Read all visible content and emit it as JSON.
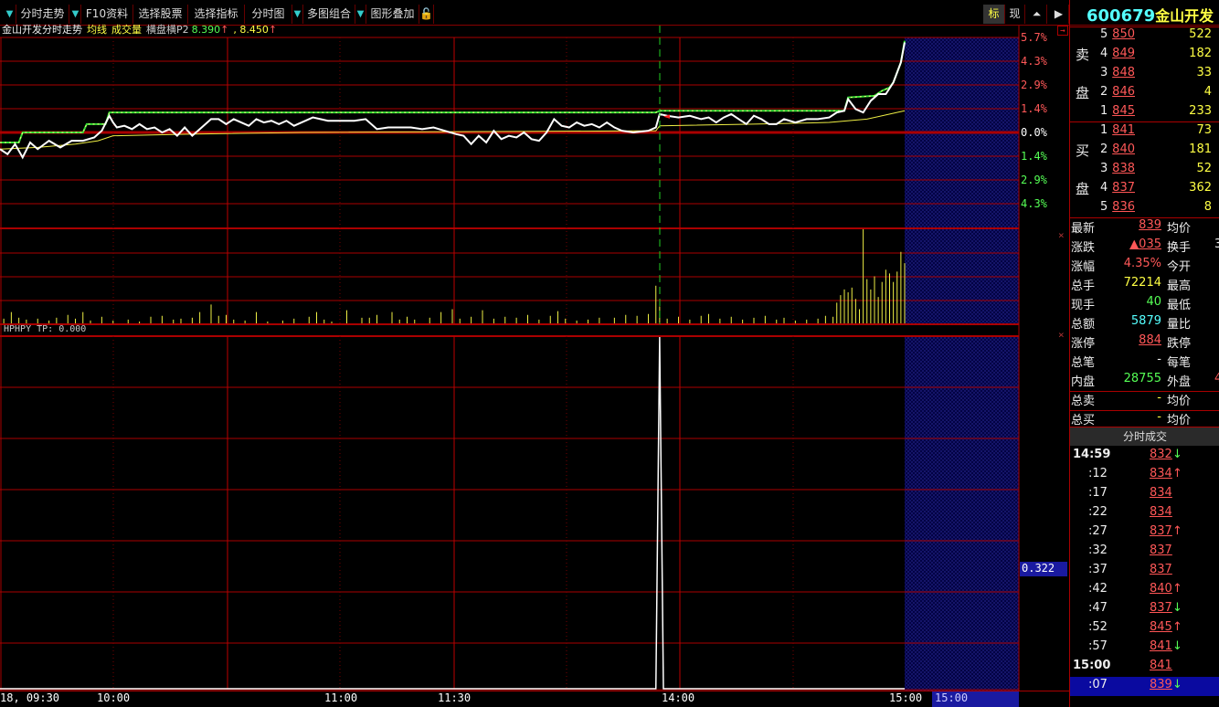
{
  "toolbar": {
    "items": [
      "分时走势",
      "F10资料",
      "选择股票",
      "选择指标",
      "分时图",
      "多图组合",
      "图形叠加"
    ],
    "right": [
      "标",
      "现"
    ]
  },
  "info": {
    "title": "金山开发分时走势",
    "ma": "均线",
    "vol": "成交量",
    "mode": "横盘横P2",
    "v1": "8.390",
    "v2": ", 8.450",
    "arrow": "↑"
  },
  "axis": {
    "price_labels": [
      "5.7%",
      "4.3%",
      "2.9%",
      "1.4%",
      "0.0%",
      "1.4%",
      "2.9%",
      "4.3%"
    ],
    "indicator_label": "HPHPY  TP: 0.000",
    "indicator_value": "0.322",
    "time_labels": [
      "18, 09:30",
      "10:00",
      "11:00",
      "11:30",
      "14:00",
      "15:00"
    ],
    "cursor_time": "15:00"
  },
  "quote": {
    "code": "600679",
    "name": "金山开发",
    "sell_label": [
      "卖",
      "盘"
    ],
    "buy_label": [
      "买",
      "盘"
    ],
    "sell": [
      {
        "lvl": "5",
        "price": "850",
        "vol": "522"
      },
      {
        "lvl": "4",
        "price": "849",
        "vol": "182"
      },
      {
        "lvl": "3",
        "price": "848",
        "vol": "33"
      },
      {
        "lvl": "2",
        "price": "846",
        "vol": "4"
      },
      {
        "lvl": "1",
        "price": "845",
        "vol": "233"
      }
    ],
    "buy": [
      {
        "lvl": "1",
        "price": "841",
        "vol": "73"
      },
      {
        "lvl": "2",
        "price": "840",
        "vol": "181"
      },
      {
        "lvl": "3",
        "price": "838",
        "vol": "52"
      },
      {
        "lvl": "4",
        "price": "837",
        "vol": "362"
      },
      {
        "lvl": "5",
        "price": "836",
        "vol": "8"
      }
    ],
    "stats": [
      {
        "l": "最新",
        "v": "839",
        "c": "red",
        "r": "均价",
        "rv": ""
      },
      {
        "l": "涨跌",
        "v": "▲035",
        "c": "red",
        "r": "换手",
        "rv": "3"
      },
      {
        "l": "涨幅",
        "v": "4.35%",
        "c": "red",
        "r": "今开",
        "rv": ""
      },
      {
        "l": "总手",
        "v": "72214",
        "c": "yel",
        "r": "最高",
        "rv": ""
      },
      {
        "l": "现手",
        "v": "40",
        "c": "grn",
        "r": "最低",
        "rv": ""
      },
      {
        "l": "总额",
        "v": "5879",
        "c": "cyn",
        "r": "量比",
        "rv": ""
      },
      {
        "l": "涨停",
        "v": "884",
        "c": "red",
        "r": "跌停",
        "rv": ""
      },
      {
        "l": "总笔",
        "v": "-",
        "c": "wht",
        "r": "每笔",
        "rv": ""
      },
      {
        "l": "内盘",
        "v": "28755",
        "c": "grn",
        "r": "外盘",
        "rv": "4"
      },
      {
        "l": "总卖",
        "v": "-",
        "c": "yel",
        "r": "均价",
        "rv": ""
      },
      {
        "l": "总买",
        "v": "-",
        "c": "yel",
        "r": "均价",
        "rv": ""
      }
    ],
    "ticks_header": "分时成交",
    "ticks": [
      {
        "t": "14:59",
        "p": "832",
        "d": "↓"
      },
      {
        "t": ":12",
        "p": "834",
        "d": "↑"
      },
      {
        "t": ":17",
        "p": "834",
        "d": ""
      },
      {
        "t": ":22",
        "p": "834",
        "d": ""
      },
      {
        "t": ":27",
        "p": "837",
        "d": "↑"
      },
      {
        "t": ":32",
        "p": "837",
        "d": ""
      },
      {
        "t": ":37",
        "p": "837",
        "d": ""
      },
      {
        "t": ":42",
        "p": "840",
        "d": "↑"
      },
      {
        "t": ":47",
        "p": "837",
        "d": "↓"
      },
      {
        "t": ":52",
        "p": "845",
        "d": "↑"
      },
      {
        "t": ":57",
        "p": "841",
        "d": "↓"
      },
      {
        "t": "15:00",
        "p": "841",
        "d": ""
      },
      {
        "t": ":07",
        "p": "839",
        "d": "↓"
      }
    ]
  },
  "chart_data": {
    "type": "line",
    "prev_close": 8.04,
    "ylim_pct": [
      -5.7,
      5.7
    ],
    "x_minutes": [
      0,
      240
    ],
    "price": [
      [
        0,
        -1.0
      ],
      [
        2,
        -1.3
      ],
      [
        4,
        -0.7
      ],
      [
        6,
        -1.5
      ],
      [
        8,
        -0.6
      ],
      [
        10,
        -1.0
      ],
      [
        13,
        -0.5
      ],
      [
        16,
        -0.9
      ],
      [
        19,
        -0.5
      ],
      [
        22,
        -0.5
      ],
      [
        25,
        -0.3
      ],
      [
        27,
        0.1
      ],
      [
        29,
        1.0
      ],
      [
        30,
        0.6
      ],
      [
        31,
        0.3
      ],
      [
        33,
        0.4
      ],
      [
        35,
        0.2
      ],
      [
        37,
        0.5
      ],
      [
        39,
        0.2
      ],
      [
        41,
        0.3
      ],
      [
        43,
        0.0
      ],
      [
        45,
        0.2
      ],
      [
        47,
        -0.2
      ],
      [
        49,
        0.3
      ],
      [
        51,
        -0.2
      ],
      [
        53,
        0.2
      ],
      [
        56,
        0.8
      ],
      [
        58,
        0.8
      ],
      [
        60,
        0.5
      ],
      [
        62,
        0.8
      ],
      [
        64,
        0.6
      ],
      [
        66,
        0.4
      ],
      [
        68,
        0.8
      ],
      [
        70,
        0.6
      ],
      [
        72,
        0.7
      ],
      [
        74,
        0.5
      ],
      [
        76,
        0.7
      ],
      [
        78,
        0.4
      ],
      [
        80,
        0.6
      ],
      [
        83,
        0.9
      ],
      [
        85,
        0.8
      ],
      [
        87,
        0.7
      ],
      [
        90,
        0.7
      ],
      [
        94,
        0.7
      ],
      [
        97,
        0.8
      ],
      [
        100,
        0.2
      ],
      [
        103,
        0.3
      ],
      [
        106,
        0.3
      ],
      [
        109,
        0.3
      ],
      [
        112,
        0.2
      ],
      [
        115,
        0.3
      ],
      [
        118,
        0.1
      ],
      [
        121,
        -0.1
      ],
      [
        123,
        -0.2
      ],
      [
        125,
        -0.7
      ],
      [
        127,
        -0.2
      ],
      [
        129,
        -0.6
      ],
      [
        131,
        0.1
      ],
      [
        133,
        -0.4
      ],
      [
        135,
        -0.2
      ],
      [
        137,
        -0.3
      ],
      [
        139,
        0.0
      ],
      [
        141,
        -0.4
      ],
      [
        143,
        -0.5
      ],
      [
        145,
        0.0
      ],
      [
        147,
        0.8
      ],
      [
        149,
        0.4
      ],
      [
        151,
        0.3
      ],
      [
        153,
        0.6
      ],
      [
        155,
        0.4
      ],
      [
        157,
        0.5
      ],
      [
        159,
        0.3
      ],
      [
        161,
        0.6
      ],
      [
        163,
        0.3
      ],
      [
        165,
        0.1
      ],
      [
        168,
        0.0
      ],
      [
        172,
        0.1
      ],
      [
        174,
        0.3
      ],
      [
        175,
        1.1
      ],
      [
        177,
        1.0
      ],
      [
        180,
        0.9
      ],
      [
        183,
        1.0
      ],
      [
        186,
        0.8
      ],
      [
        188,
        0.9
      ],
      [
        190,
        0.6
      ],
      [
        192,
        0.9
      ],
      [
        194,
        1.1
      ],
      [
        196,
        0.8
      ],
      [
        198,
        0.5
      ],
      [
        200,
        1.0
      ],
      [
        202,
        0.8
      ],
      [
        204,
        0.5
      ],
      [
        206,
        0.5
      ],
      [
        208,
        0.8
      ],
      [
        211,
        0.6
      ],
      [
        214,
        0.8
      ],
      [
        217,
        0.8
      ],
      [
        220,
        0.9
      ],
      [
        222,
        1.2
      ],
      [
        224,
        1.3
      ],
      [
        225,
        2.0
      ],
      [
        227,
        1.4
      ],
      [
        229,
        1.2
      ],
      [
        231,
        1.9
      ],
      [
        233,
        2.3
      ],
      [
        235,
        2.3
      ],
      [
        237,
        3.0
      ],
      [
        239,
        4.2
      ],
      [
        240,
        5.4
      ]
    ],
    "high": [
      [
        0,
        -0.6
      ],
      [
        5,
        -0.6
      ],
      [
        6,
        0.0
      ],
      [
        22,
        0.0
      ],
      [
        23,
        0.5
      ],
      [
        28,
        0.5
      ],
      [
        29,
        1.2
      ],
      [
        174,
        1.2
      ],
      [
        175,
        1.3
      ],
      [
        224,
        1.3
      ],
      [
        225,
        2.1
      ],
      [
        232,
        2.2
      ],
      [
        234,
        2.5
      ],
      [
        236,
        2.7
      ],
      [
        237,
        3.0
      ],
      [
        239,
        4.2
      ],
      [
        240,
        5.5
      ]
    ],
    "avg": [
      [
        0,
        -1.0
      ],
      [
        10,
        -0.9
      ],
      [
        20,
        -0.7
      ],
      [
        26,
        -0.5
      ],
      [
        30,
        -0.2
      ],
      [
        50,
        -0.1
      ],
      [
        80,
        0.0
      ],
      [
        174,
        0.1
      ],
      [
        175,
        0.4
      ],
      [
        200,
        0.5
      ],
      [
        220,
        0.6
      ],
      [
        230,
        0.8
      ],
      [
        240,
        1.3
      ]
    ],
    "volume": [
      [
        1,
        5
      ],
      [
        3,
        12
      ],
      [
        5,
        6
      ],
      [
        7,
        4
      ],
      [
        10,
        5
      ],
      [
        13,
        3
      ],
      [
        15,
        6
      ],
      [
        18,
        9
      ],
      [
        20,
        5
      ],
      [
        22,
        12
      ],
      [
        24,
        3
      ],
      [
        27,
        7
      ],
      [
        30,
        3
      ],
      [
        34,
        4
      ],
      [
        37,
        2
      ],
      [
        40,
        7
      ],
      [
        43,
        8
      ],
      [
        46,
        4
      ],
      [
        48,
        5
      ],
      [
        51,
        6
      ],
      [
        53,
        12
      ],
      [
        56,
        20
      ],
      [
        58,
        8
      ],
      [
        60,
        9
      ],
      [
        62,
        4
      ],
      [
        65,
        3
      ],
      [
        68,
        12
      ],
      [
        71,
        2
      ],
      [
        75,
        3
      ],
      [
        78,
        5
      ],
      [
        82,
        7
      ],
      [
        84,
        12
      ],
      [
        86,
        4
      ],
      [
        88,
        2
      ],
      [
        92,
        14
      ],
      [
        96,
        6
      ],
      [
        98,
        6
      ],
      [
        100,
        9
      ],
      [
        104,
        12
      ],
      [
        106,
        4
      ],
      [
        108,
        7
      ],
      [
        110,
        4
      ],
      [
        114,
        6
      ],
      [
        117,
        12
      ],
      [
        120,
        15
      ],
      [
        122,
        5
      ],
      [
        125,
        7
      ],
      [
        128,
        14
      ],
      [
        131,
        5
      ],
      [
        134,
        7
      ],
      [
        137,
        6
      ],
      [
        140,
        9
      ],
      [
        143,
        4
      ],
      [
        146,
        8
      ],
      [
        148,
        13
      ],
      [
        150,
        5
      ],
      [
        153,
        3
      ],
      [
        156,
        4
      ],
      [
        159,
        6
      ],
      [
        163,
        6
      ],
      [
        166,
        9
      ],
      [
        169,
        8
      ],
      [
        172,
        10
      ],
      [
        174,
        40
      ],
      [
        175,
        18
      ],
      [
        177,
        5
      ],
      [
        180,
        7
      ],
      [
        183,
        4
      ],
      [
        186,
        8
      ],
      [
        188,
        10
      ],
      [
        191,
        5
      ],
      [
        194,
        7
      ],
      [
        197,
        4
      ],
      [
        200,
        6
      ],
      [
        203,
        8
      ],
      [
        206,
        4
      ],
      [
        208,
        6
      ],
      [
        211,
        3
      ],
      [
        214,
        4
      ],
      [
        217,
        5
      ],
      [
        219,
        8
      ],
      [
        221,
        7
      ],
      [
        222,
        22
      ],
      [
        223,
        30
      ],
      [
        224,
        36
      ],
      [
        225,
        33
      ],
      [
        226,
        38
      ],
      [
        227,
        26
      ],
      [
        228,
        15
      ],
      [
        229,
        100
      ],
      [
        230,
        47
      ],
      [
        231,
        36
      ],
      [
        232,
        50
      ],
      [
        233,
        28
      ],
      [
        234,
        44
      ],
      [
        235,
        57
      ],
      [
        236,
        53
      ],
      [
        237,
        44
      ],
      [
        238,
        55
      ],
      [
        239,
        76
      ],
      [
        240,
        64
      ]
    ],
    "indicator": [
      [
        0,
        0
      ],
      [
        174,
        0
      ],
      [
        175,
        1
      ],
      [
        176,
        0
      ],
      [
        240,
        0
      ]
    ]
  }
}
